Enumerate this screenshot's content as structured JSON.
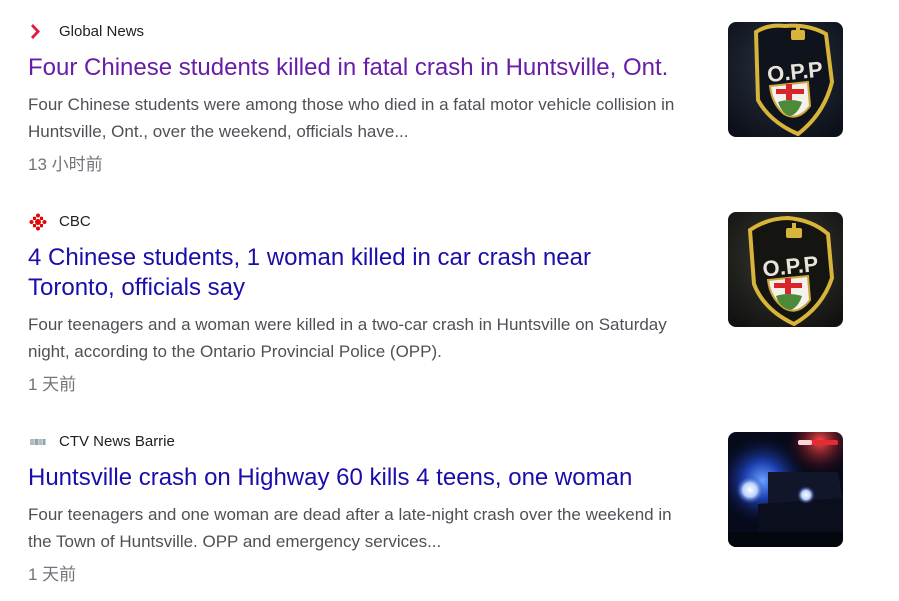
{
  "results": [
    {
      "source": "Global News",
      "source_icon": "global-news-icon",
      "title": "Four Chinese students killed in fatal crash in Huntsville, Ont.",
      "snippet_line1": "Four Chinese students were among those who died in a fatal motor vehicle collision in",
      "snippet_line2": "Huntsville, Ont., over the weekend, officials have...",
      "age": "13 小时前",
      "visited": true,
      "thumb_badge": "O.P.P"
    },
    {
      "source": "CBC",
      "source_icon": "cbc-gem-icon",
      "title_line1": "4 Chinese students, 1 woman killed in car crash near",
      "title_line2": "Toronto, officials say",
      "snippet_line1": "Four teenagers and a woman were killed in a two-car crash in Huntsville on Saturday",
      "snippet_line2": "night, according to the Ontario Provincial Police (OPP).",
      "age": "1 天前",
      "visited": false,
      "thumb_badge": "O.P.P"
    },
    {
      "source": "CTV News Barrie",
      "source_icon": "ctv-news-icon",
      "title": "Huntsville crash on Highway 60 kills 4 teens, one woman",
      "snippet_line1": "Four teenagers and one woman are dead after a late-night crash over the weekend in",
      "snippet_line2": "the Town of Huntsville. OPP and emergency services...",
      "age": "1 天前",
      "visited": false
    }
  ],
  "colors": {
    "link": "#1a0dab",
    "visited_link": "#681da8",
    "snippet": "#4d5156",
    "meta": "#70757a",
    "source": "#202124",
    "global_news_red": "#e31937",
    "cbc_red": "#e60505"
  }
}
